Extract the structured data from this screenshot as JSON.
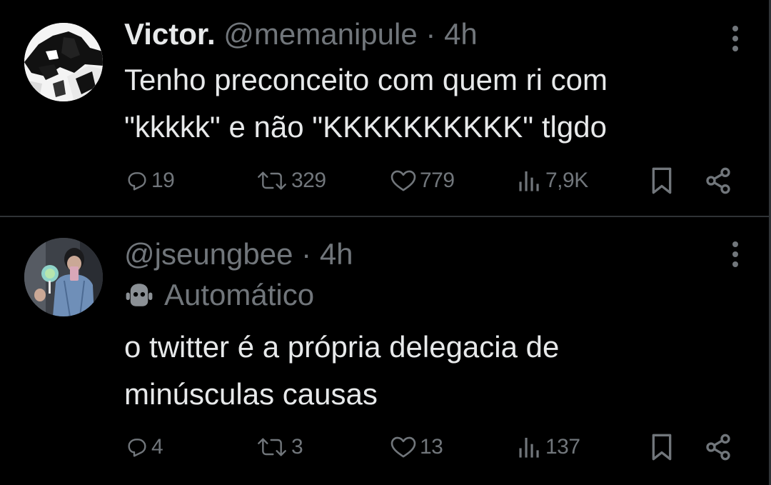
{
  "tweets": [
    {
      "name": "Victor.",
      "handle": "@memanipule",
      "separator": "·",
      "time": "4h",
      "lines": [
        "Tenho preconceito com quem ri com",
        "\"kkkkk\" e não \"KKKKKKKKKK\" tlgdo"
      ],
      "replies": "19",
      "retweets": "329",
      "likes": "779",
      "views": "7,9K"
    },
    {
      "name": "",
      "handle": "@jseungbee",
      "separator": "·",
      "time": "4h",
      "label": "Automático",
      "lines": [
        "o twitter é a própria delegacia de",
        "minúsculas causas"
      ],
      "replies": "4",
      "retweets": "3",
      "likes": "13",
      "views": "137"
    }
  ],
  "icons": {
    "reply": "reply-icon",
    "retweet": "retweet-icon",
    "like": "heart-icon",
    "views": "views-icon",
    "bookmark": "bookmark-icon",
    "share": "share-icon",
    "more": "more-vertical-icon",
    "bot": "bot-icon"
  },
  "colors": {
    "background": "#000000",
    "text": "#e7e9ea",
    "muted": "#71767b",
    "divider": "#2f3336"
  }
}
